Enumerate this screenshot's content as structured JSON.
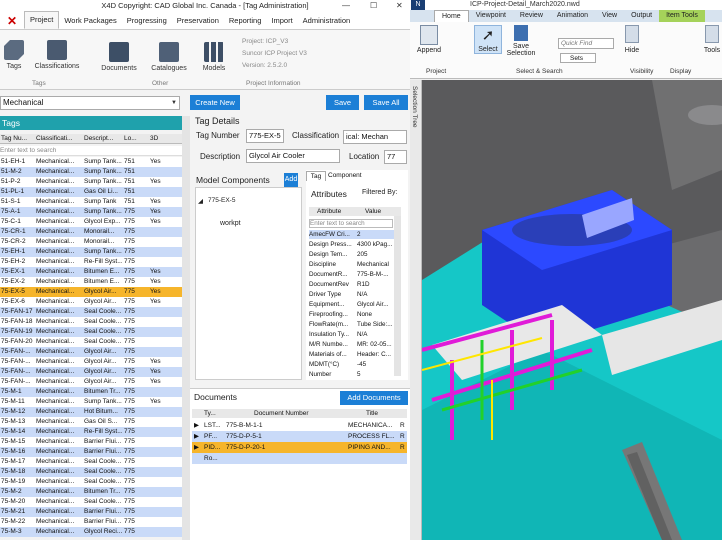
{
  "app": {
    "title": "X4D Copyright: CAD Global Inc. Canada - [Tag Administration]",
    "menu": [
      "Project",
      "Work Packages",
      "Progressing",
      "Preservation",
      "Reporting",
      "Import",
      "Administration"
    ],
    "ribbon": {
      "tags": "Tags",
      "classifications": "Classifications",
      "documents": "Documents",
      "catalogues": "Catalogues",
      "models": "Models",
      "group_tags": "Tags",
      "group_other": "Other",
      "group_project": "Project Information",
      "project_lines": [
        "Project: ICP_V3",
        "Suncor ICP Project V3",
        "Version: 2.5.2.0"
      ]
    }
  },
  "toolbar": {
    "discipline": "Mechanical",
    "new": "Create New",
    "save": "Save",
    "save_all": "Save All"
  },
  "tags": {
    "header": "Tags",
    "columns": [
      "Tag Nu...",
      "Classificati...",
      "Descript...",
      "Lo...",
      "3D"
    ],
    "filter_placeholder": "Enter text to search",
    "rows": [
      [
        "51-EH-1",
        "Mechanical...",
        "Sump Tank...",
        "751",
        "Yes"
      ],
      [
        "51-M-2",
        "Mechanical...",
        "Sump Tank...",
        "751",
        ""
      ],
      [
        "51-P-2",
        "Mechanical...",
        "Sump Tank...",
        "751",
        "Yes"
      ],
      [
        "51-PL-1",
        "Mechanical...",
        "Gas Oil Li...",
        "751",
        ""
      ],
      [
        "51-S-1",
        "Mechanical...",
        "Sump Tank",
        "751",
        "Yes"
      ],
      [
        "75-A-1",
        "Mechanical...",
        "Sump Tank...",
        "775",
        "Yes"
      ],
      [
        "75-C-1",
        "Mechanical...",
        "Glycol Exp...",
        "775",
        "Yes"
      ],
      [
        "75-CR-1",
        "Mechanical...",
        "Monorail...",
        "775",
        ""
      ],
      [
        "75-CR-2",
        "Mechanical...",
        "Monorail...",
        "775",
        ""
      ],
      [
        "75-EH-1",
        "Mechanical...",
        "Sump Tank...",
        "775",
        ""
      ],
      [
        "75-EH-2",
        "Mechanical...",
        "Re-Fill Syst...",
        "775",
        ""
      ],
      [
        "75-EX-1",
        "Mechanical...",
        "Bitumen E...",
        "775",
        "Yes"
      ],
      [
        "75-EX-2",
        "Mechanical...",
        "Bitumen E...",
        "775",
        "Yes"
      ],
      [
        "75-EX-5",
        "Mechanical...",
        "Glycol Air...",
        "775",
        "Yes"
      ],
      [
        "75-EX-6",
        "Mechanical...",
        "Glycol Air...",
        "775",
        "Yes"
      ],
      [
        "75-FAN-17",
        "Mechanical...",
        "Seal Coole...",
        "775",
        ""
      ],
      [
        "75-FAN-18",
        "Mechanical...",
        "Seal Coole...",
        "775",
        ""
      ],
      [
        "75-FAN-19",
        "Mechanical...",
        "Seal Coole...",
        "775",
        ""
      ],
      [
        "75-FAN-20",
        "Mechanical...",
        "Seal Coole...",
        "775",
        ""
      ],
      [
        "75-FAN-...",
        "Mechanical...",
        "Glycol Air...",
        "775",
        ""
      ],
      [
        "75-FAN-...",
        "Mechanical...",
        "Glycol Air...",
        "775",
        "Yes"
      ],
      [
        "75-FAN-...",
        "Mechanical...",
        "Glycol Air...",
        "775",
        "Yes"
      ],
      [
        "75-FAN-...",
        "Mechanical...",
        "Glycol Air...",
        "775",
        "Yes"
      ],
      [
        "75-M-1",
        "Mechanical...",
        "Bitumen Tr...",
        "775",
        ""
      ],
      [
        "75-M-11",
        "Mechanical...",
        "Sump Tank...",
        "775",
        "Yes"
      ],
      [
        "75-M-12",
        "Mechanical...",
        "Hot Bitum...",
        "775",
        ""
      ],
      [
        "75-M-13",
        "Mechanical...",
        "Gas Oil S...",
        "775",
        ""
      ],
      [
        "75-M-14",
        "Mechanical...",
        "Re-Fill Syst...",
        "775",
        ""
      ],
      [
        "75-M-15",
        "Mechanical...",
        "Barrier Flui...",
        "775",
        ""
      ],
      [
        "75-M-16",
        "Mechanical...",
        "Barrier Flui...",
        "775",
        ""
      ],
      [
        "75-M-17",
        "Mechanical...",
        "Seal Coole...",
        "775",
        ""
      ],
      [
        "75-M-18",
        "Mechanical...",
        "Seal Coole...",
        "775",
        ""
      ],
      [
        "75-M-19",
        "Mechanical...",
        "Seal Coole...",
        "775",
        ""
      ],
      [
        "75-M-2",
        "Mechanical...",
        "Bitumen Tr...",
        "775",
        ""
      ],
      [
        "75-M-20",
        "Mechanical...",
        "Seal Coole...",
        "775",
        ""
      ],
      [
        "75-M-21",
        "Mechanical...",
        "Barrier Flui...",
        "775",
        ""
      ],
      [
        "75-M-22",
        "Mechanical...",
        "Barrier Flui...",
        "775",
        ""
      ],
      [
        "75-M-3",
        "Mechanical...",
        "Glycol Reci...",
        "775",
        ""
      ]
    ]
  },
  "details": {
    "header": "Tag Details",
    "tag_number_label": "Tag Number",
    "tag_number": "775-EX-5",
    "classification_label": "Classification",
    "classification": "ical: Mechan",
    "description_label": "Description",
    "description": "Glycol Air Cooler",
    "location_label": "Location",
    "location": "77",
    "model_components": "Model Components",
    "add": "Add",
    "tree_root": "775-EX-5",
    "tree_child": "workpt",
    "tab_tag": "Tag",
    "tab_component": "Component",
    "attributes": "Attributes",
    "filtered_by": "Filtered By:",
    "attr_cols": [
      "Attribute",
      "Value"
    ],
    "attr_filter": "Enter text to search",
    "attrs": [
      [
        "AmecFW Cri...",
        "2"
      ],
      [
        "Design Press...",
        "4300 kPag..."
      ],
      [
        "Design Tem...",
        "205"
      ],
      [
        "Discipline",
        "Mechanical"
      ],
      [
        "DocumentR...",
        "775-B-M-..."
      ],
      [
        "DocumentRev",
        "R1D"
      ],
      [
        "Driver Type",
        "N/A"
      ],
      [
        "Equipment...",
        "Glycol Air..."
      ],
      [
        "Fireproofing...",
        "None"
      ],
      [
        "FlowRate(m...",
        "Tube Side:..."
      ],
      [
        "Insulation Ty...",
        "N/A"
      ],
      [
        "M/R Numbe...",
        "MR: 02-05..."
      ],
      [
        "Materials of...",
        "Header: C..."
      ],
      [
        "MDMT(°C)",
        "-45"
      ],
      [
        "Number",
        "5"
      ]
    ]
  },
  "documents": {
    "header": "Documents",
    "add": "Add Documents",
    "cols": [
      "Ty...",
      "Document Number",
      "Title",
      ""
    ],
    "rows": [
      [
        "LST...",
        "775-B-M-1-1",
        "MECHANICA...",
        "R"
      ],
      [
        "PF...",
        "775-D-P-5-1",
        "PROCESS FL...",
        "R"
      ],
      [
        "PID...",
        "775-D-P-20-1",
        "PIPING AND...",
        "R"
      ],
      [
        "Ro...",
        "",
        "",
        ""
      ]
    ]
  },
  "nav": {
    "title": "ICP-Project-Detail_March2020.nwd",
    "tabs": [
      "Home",
      "Viewpoint",
      "Review",
      "Animation",
      "View",
      "Output",
      "Item Tools"
    ],
    "append": "Append",
    "select": "Select",
    "save_selection": "Save Selection",
    "quick_find": "Quick Find",
    "sets": "Sets",
    "hide": "Hide",
    "tools": "Tools",
    "groups": [
      "Project",
      "Select & Search",
      "Visibility",
      "Display"
    ],
    "selection_tree": "Selection Tree"
  }
}
